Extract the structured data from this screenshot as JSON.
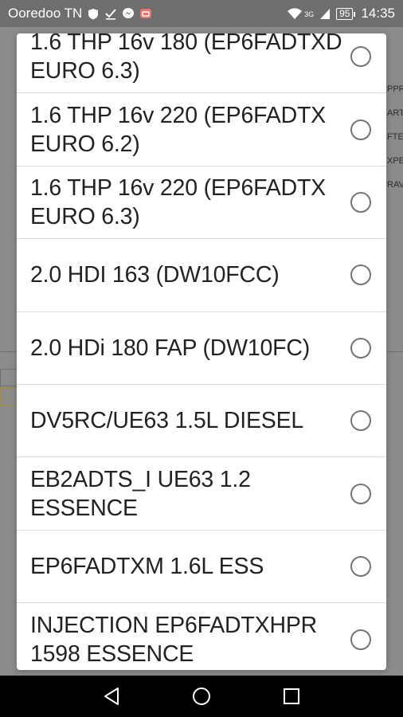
{
  "status_bar": {
    "carrier": "Ooredoo TN",
    "network": "3G",
    "battery": "95",
    "time": "14:35"
  },
  "background": {
    "text_fragments": [
      "PPR",
      "ART",
      "FTE",
      "XPE",
      "RAV"
    ]
  },
  "dialog": {
    "options": [
      {
        "label": "1.6 THP 16v 180 (EP6FADTXD EURO 6.3)",
        "selected": false
      },
      {
        "label": "1.6 THP 16v 220 (EP6FADTX EURO 6.2)",
        "selected": false
      },
      {
        "label": "1.6 THP 16v 220 (EP6FADTX EURO 6.3)",
        "selected": false
      },
      {
        "label": "2.0 HDI 163 (DW10FCC)",
        "selected": false
      },
      {
        "label": "2.0 HDi 180 FAP (DW10FC)",
        "selected": false
      },
      {
        "label": "DV5RC/UE63 1.5L DIESEL",
        "selected": false
      },
      {
        "label": "EB2ADTS_I UE63 1.2 ESSENCE",
        "selected": false
      },
      {
        "label": "EP6FADTXM 1.6L ESS",
        "selected": false
      },
      {
        "label": "INJECTION EP6FADTXHPR 1598 ESSENCE",
        "selected": false
      }
    ]
  },
  "nav_bar": {
    "icons": [
      "back-icon",
      "home-icon",
      "recents-icon"
    ]
  }
}
